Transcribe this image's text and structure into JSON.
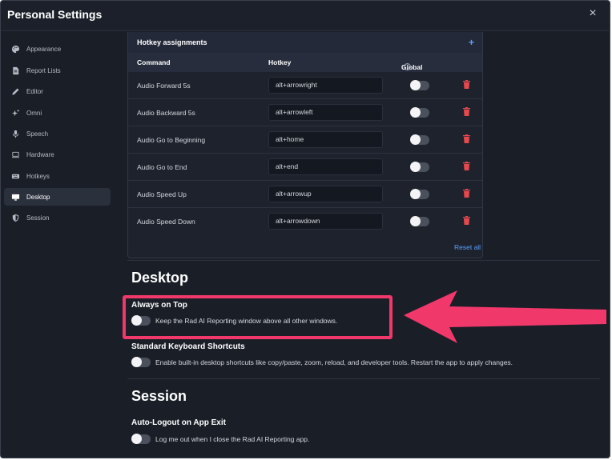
{
  "window": {
    "title": "Personal Settings",
    "close_glyph": "×"
  },
  "sidebar": {
    "items": [
      {
        "label": "Appearance",
        "icon": "palette-icon"
      },
      {
        "label": "Report Lists",
        "icon": "document-icon"
      },
      {
        "label": "Editor",
        "icon": "pencil-icon"
      },
      {
        "label": "Omni",
        "icon": "sparkle-icon"
      },
      {
        "label": "Speech",
        "icon": "microphone-icon"
      },
      {
        "label": "Hardware",
        "icon": "laptop-icon"
      },
      {
        "label": "Hotkeys",
        "icon": "keyboard-icon"
      },
      {
        "label": "Desktop",
        "icon": "monitor-icon",
        "active": true
      },
      {
        "label": "Session",
        "icon": "shield-icon"
      }
    ]
  },
  "hotkeys": {
    "title": "Hotkey assignments",
    "add_glyph": "+",
    "columns": {
      "command": "Command",
      "hotkey": "Hotkey",
      "global": "Global",
      "info_glyph": "?"
    },
    "rows": [
      {
        "command": "Audio Forward 5s",
        "hotkey": "alt+arrowright",
        "global": false
      },
      {
        "command": "Audio Backward 5s",
        "hotkey": "alt+arrowleft",
        "global": false
      },
      {
        "command": "Audio Go to Beginning",
        "hotkey": "alt+home",
        "global": false
      },
      {
        "command": "Audio Go to End",
        "hotkey": "alt+end",
        "global": false
      },
      {
        "command": "Audio Speed Up",
        "hotkey": "alt+arrowup",
        "global": false
      },
      {
        "command": "Audio Speed Down",
        "hotkey": "alt+arrowdown",
        "global": false
      }
    ],
    "reset_label": "Reset all"
  },
  "desktop": {
    "title": "Desktop",
    "always_on_top": {
      "label": "Always on Top",
      "description": "Keep the Rad AI Reporting window above all other windows.",
      "enabled": false
    },
    "keyboard_shortcuts": {
      "label": "Standard Keyboard Shortcuts",
      "description": "Enable built-in desktop shortcuts like copy/paste, zoom, reload, and developer tools. Restart the app to apply changes.",
      "enabled": false
    }
  },
  "session": {
    "title": "Session",
    "auto_logout": {
      "label": "Auto-Logout on App Exit",
      "description": "Log me out when I close the Rad AI Reporting app.",
      "enabled": false
    }
  },
  "colors": {
    "background": "#1a1e27",
    "accent_link": "#5aa0ff",
    "delete_red": "#e5484d",
    "annotation": "#f0386b"
  }
}
